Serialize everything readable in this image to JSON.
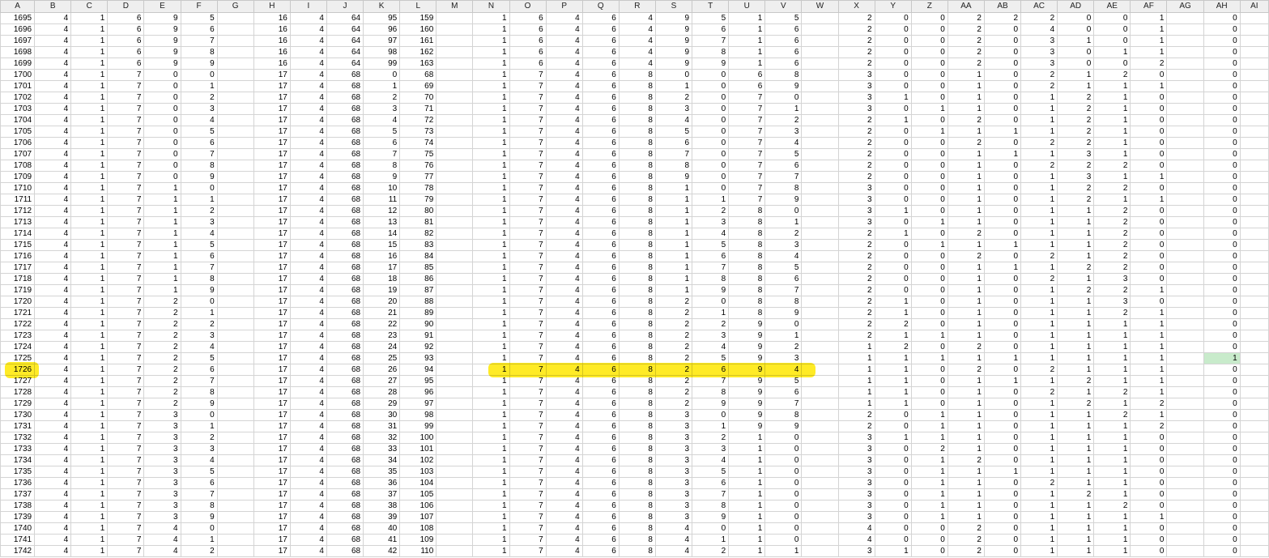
{
  "colors": {
    "highlight": "#ffe800",
    "selected_cell": "#c8ebcb",
    "header_bg": "#efefef",
    "grid_line": "#d4d4d4"
  },
  "columns": [
    "A",
    "B",
    "C",
    "D",
    "E",
    "F",
    "G",
    "H",
    "I",
    "J",
    "K",
    "L",
    "M",
    "N",
    "O",
    "P",
    "Q",
    "R",
    "S",
    "T",
    "U",
    "V",
    "W",
    "X",
    "Y",
    "Z",
    "AA",
    "AB",
    "AC",
    "AD",
    "AE",
    "AF",
    "AG",
    "AH",
    "AI"
  ],
  "highlighted_row_id": "1725",
  "selected_cell": {
    "row_id": "1725",
    "column": "AH"
  },
  "rows": [
    [
      "1695",
      "4",
      "1",
      "6",
      "9",
      "5",
      "",
      "16",
      "4",
      "64",
      "95",
      "159",
      "",
      "1",
      "6",
      "4",
      "6",
      "4",
      "9",
      "5",
      "1",
      "5",
      "",
      "2",
      "0",
      "0",
      "2",
      "2",
      "2",
      "0",
      "0",
      "1",
      "",
      "0",
      ""
    ],
    [
      "1696",
      "4",
      "1",
      "6",
      "9",
      "6",
      "",
      "16",
      "4",
      "64",
      "96",
      "160",
      "",
      "1",
      "6",
      "4",
      "6",
      "4",
      "9",
      "6",
      "1",
      "6",
      "",
      "2",
      "0",
      "0",
      "2",
      "0",
      "4",
      "0",
      "0",
      "1",
      "",
      "0",
      ""
    ],
    [
      "1697",
      "4",
      "1",
      "6",
      "9",
      "7",
      "",
      "16",
      "4",
      "64",
      "97",
      "161",
      "",
      "1",
      "6",
      "4",
      "6",
      "4",
      "9",
      "7",
      "1",
      "6",
      "",
      "2",
      "0",
      "0",
      "2",
      "0",
      "3",
      "1",
      "0",
      "1",
      "",
      "0",
      ""
    ],
    [
      "1698",
      "4",
      "1",
      "6",
      "9",
      "8",
      "",
      "16",
      "4",
      "64",
      "98",
      "162",
      "",
      "1",
      "6",
      "4",
      "6",
      "4",
      "9",
      "8",
      "1",
      "6",
      "",
      "2",
      "0",
      "0",
      "2",
      "0",
      "3",
      "0",
      "1",
      "1",
      "",
      "0",
      ""
    ],
    [
      "1699",
      "4",
      "1",
      "6",
      "9",
      "9",
      "",
      "16",
      "4",
      "64",
      "99",
      "163",
      "",
      "1",
      "6",
      "4",
      "6",
      "4",
      "9",
      "9",
      "1",
      "6",
      "",
      "2",
      "0",
      "0",
      "2",
      "0",
      "3",
      "0",
      "0",
      "2",
      "",
      "0",
      ""
    ],
    [
      "1700",
      "4",
      "1",
      "7",
      "0",
      "0",
      "",
      "17",
      "4",
      "68",
      "0",
      "68",
      "",
      "1",
      "7",
      "4",
      "6",
      "8",
      "0",
      "0",
      "6",
      "8",
      "",
      "3",
      "0",
      "0",
      "1",
      "0",
      "2",
      "1",
      "2",
      "0",
      "",
      "0",
      ""
    ],
    [
      "1701",
      "4",
      "1",
      "7",
      "0",
      "1",
      "",
      "17",
      "4",
      "68",
      "1",
      "69",
      "",
      "1",
      "7",
      "4",
      "6",
      "8",
      "1",
      "0",
      "6",
      "9",
      "",
      "3",
      "0",
      "0",
      "1",
      "0",
      "2",
      "1",
      "1",
      "1",
      "",
      "0",
      ""
    ],
    [
      "1702",
      "4",
      "1",
      "7",
      "0",
      "2",
      "",
      "17",
      "4",
      "68",
      "2",
      "70",
      "",
      "1",
      "7",
      "4",
      "6",
      "8",
      "2",
      "0",
      "7",
      "0",
      "",
      "3",
      "1",
      "0",
      "1",
      "0",
      "1",
      "2",
      "1",
      "0",
      "",
      "0",
      ""
    ],
    [
      "1703",
      "4",
      "1",
      "7",
      "0",
      "3",
      "",
      "17",
      "4",
      "68",
      "3",
      "71",
      "",
      "1",
      "7",
      "4",
      "6",
      "8",
      "3",
      "0",
      "7",
      "1",
      "",
      "3",
      "0",
      "1",
      "1",
      "0",
      "1",
      "2",
      "1",
      "0",
      "",
      "0",
      ""
    ],
    [
      "1704",
      "4",
      "1",
      "7",
      "0",
      "4",
      "",
      "17",
      "4",
      "68",
      "4",
      "72",
      "",
      "1",
      "7",
      "4",
      "6",
      "8",
      "4",
      "0",
      "7",
      "2",
      "",
      "2",
      "1",
      "0",
      "2",
      "0",
      "1",
      "2",
      "1",
      "0",
      "",
      "0",
      ""
    ],
    [
      "1705",
      "4",
      "1",
      "7",
      "0",
      "5",
      "",
      "17",
      "4",
      "68",
      "5",
      "73",
      "",
      "1",
      "7",
      "4",
      "6",
      "8",
      "5",
      "0",
      "7",
      "3",
      "",
      "2",
      "0",
      "1",
      "1",
      "1",
      "1",
      "2",
      "1",
      "0",
      "",
      "0",
      ""
    ],
    [
      "1706",
      "4",
      "1",
      "7",
      "0",
      "6",
      "",
      "17",
      "4",
      "68",
      "6",
      "74",
      "",
      "1",
      "7",
      "4",
      "6",
      "8",
      "6",
      "0",
      "7",
      "4",
      "",
      "2",
      "0",
      "0",
      "2",
      "0",
      "2",
      "2",
      "1",
      "0",
      "",
      "0",
      ""
    ],
    [
      "1707",
      "4",
      "1",
      "7",
      "0",
      "7",
      "",
      "17",
      "4",
      "68",
      "7",
      "75",
      "",
      "1",
      "7",
      "4",
      "6",
      "8",
      "7",
      "0",
      "7",
      "5",
      "",
      "2",
      "0",
      "0",
      "1",
      "1",
      "1",
      "3",
      "1",
      "0",
      "",
      "0",
      ""
    ],
    [
      "1708",
      "4",
      "1",
      "7",
      "0",
      "8",
      "",
      "17",
      "4",
      "68",
      "8",
      "76",
      "",
      "1",
      "7",
      "4",
      "6",
      "8",
      "8",
      "0",
      "7",
      "6",
      "",
      "2",
      "0",
      "0",
      "1",
      "0",
      "2",
      "2",
      "2",
      "0",
      "",
      "0",
      ""
    ],
    [
      "1709",
      "4",
      "1",
      "7",
      "0",
      "9",
      "",
      "17",
      "4",
      "68",
      "9",
      "77",
      "",
      "1",
      "7",
      "4",
      "6",
      "8",
      "9",
      "0",
      "7",
      "7",
      "",
      "2",
      "0",
      "0",
      "1",
      "0",
      "1",
      "3",
      "1",
      "1",
      "",
      "0",
      ""
    ],
    [
      "1710",
      "4",
      "1",
      "7",
      "1",
      "0",
      "",
      "17",
      "4",
      "68",
      "10",
      "78",
      "",
      "1",
      "7",
      "4",
      "6",
      "8",
      "1",
      "0",
      "7",
      "8",
      "",
      "3",
      "0",
      "0",
      "1",
      "0",
      "1",
      "2",
      "2",
      "0",
      "",
      "0",
      ""
    ],
    [
      "1711",
      "4",
      "1",
      "7",
      "1",
      "1",
      "",
      "17",
      "4",
      "68",
      "11",
      "79",
      "",
      "1",
      "7",
      "4",
      "6",
      "8",
      "1",
      "1",
      "7",
      "9",
      "",
      "3",
      "0",
      "0",
      "1",
      "0",
      "1",
      "2",
      "1",
      "1",
      "",
      "0",
      ""
    ],
    [
      "1712",
      "4",
      "1",
      "7",
      "1",
      "2",
      "",
      "17",
      "4",
      "68",
      "12",
      "80",
      "",
      "1",
      "7",
      "4",
      "6",
      "8",
      "1",
      "2",
      "8",
      "0",
      "",
      "3",
      "1",
      "0",
      "1",
      "0",
      "1",
      "1",
      "2",
      "0",
      "",
      "0",
      ""
    ],
    [
      "1713",
      "4",
      "1",
      "7",
      "1",
      "3",
      "",
      "17",
      "4",
      "68",
      "13",
      "81",
      "",
      "1",
      "7",
      "4",
      "6",
      "8",
      "1",
      "3",
      "8",
      "1",
      "",
      "3",
      "0",
      "1",
      "1",
      "0",
      "1",
      "1",
      "2",
      "0",
      "",
      "0",
      ""
    ],
    [
      "1714",
      "4",
      "1",
      "7",
      "1",
      "4",
      "",
      "17",
      "4",
      "68",
      "14",
      "82",
      "",
      "1",
      "7",
      "4",
      "6",
      "8",
      "1",
      "4",
      "8",
      "2",
      "",
      "2",
      "1",
      "0",
      "2",
      "0",
      "1",
      "1",
      "2",
      "0",
      "",
      "0",
      ""
    ],
    [
      "1715",
      "4",
      "1",
      "7",
      "1",
      "5",
      "",
      "17",
      "4",
      "68",
      "15",
      "83",
      "",
      "1",
      "7",
      "4",
      "6",
      "8",
      "1",
      "5",
      "8",
      "3",
      "",
      "2",
      "0",
      "1",
      "1",
      "1",
      "1",
      "1",
      "2",
      "0",
      "",
      "0",
      ""
    ],
    [
      "1716",
      "4",
      "1",
      "7",
      "1",
      "6",
      "",
      "17",
      "4",
      "68",
      "16",
      "84",
      "",
      "1",
      "7",
      "4",
      "6",
      "8",
      "1",
      "6",
      "8",
      "4",
      "",
      "2",
      "0",
      "0",
      "2",
      "0",
      "2",
      "1",
      "2",
      "0",
      "",
      "0",
      ""
    ],
    [
      "1717",
      "4",
      "1",
      "7",
      "1",
      "7",
      "",
      "17",
      "4",
      "68",
      "17",
      "85",
      "",
      "1",
      "7",
      "4",
      "6",
      "8",
      "1",
      "7",
      "8",
      "5",
      "",
      "2",
      "0",
      "0",
      "1",
      "1",
      "1",
      "2",
      "2",
      "0",
      "",
      "0",
      ""
    ],
    [
      "1718",
      "4",
      "1",
      "7",
      "1",
      "8",
      "",
      "17",
      "4",
      "68",
      "18",
      "86",
      "",
      "1",
      "7",
      "4",
      "6",
      "8",
      "1",
      "8",
      "8",
      "6",
      "",
      "2",
      "0",
      "0",
      "1",
      "0",
      "2",
      "1",
      "3",
      "0",
      "",
      "0",
      ""
    ],
    [
      "1719",
      "4",
      "1",
      "7",
      "1",
      "9",
      "",
      "17",
      "4",
      "68",
      "19",
      "87",
      "",
      "1",
      "7",
      "4",
      "6",
      "8",
      "1",
      "9",
      "8",
      "7",
      "",
      "2",
      "0",
      "0",
      "1",
      "0",
      "1",
      "2",
      "2",
      "1",
      "",
      "0",
      ""
    ],
    [
      "1720",
      "4",
      "1",
      "7",
      "2",
      "0",
      "",
      "17",
      "4",
      "68",
      "20",
      "88",
      "",
      "1",
      "7",
      "4",
      "6",
      "8",
      "2",
      "0",
      "8",
      "8",
      "",
      "2",
      "1",
      "0",
      "1",
      "0",
      "1",
      "1",
      "3",
      "0",
      "",
      "0",
      ""
    ],
    [
      "1721",
      "4",
      "1",
      "7",
      "2",
      "1",
      "",
      "17",
      "4",
      "68",
      "21",
      "89",
      "",
      "1",
      "7",
      "4",
      "6",
      "8",
      "2",
      "1",
      "8",
      "9",
      "",
      "2",
      "1",
      "0",
      "1",
      "0",
      "1",
      "1",
      "2",
      "1",
      "",
      "0",
      ""
    ],
    [
      "1722",
      "4",
      "1",
      "7",
      "2",
      "2",
      "",
      "17",
      "4",
      "68",
      "22",
      "90",
      "",
      "1",
      "7",
      "4",
      "6",
      "8",
      "2",
      "2",
      "9",
      "0",
      "",
      "2",
      "2",
      "0",
      "1",
      "0",
      "1",
      "1",
      "1",
      "1",
      "",
      "0",
      ""
    ],
    [
      "1723",
      "4",
      "1",
      "7",
      "2",
      "3",
      "",
      "17",
      "4",
      "68",
      "23",
      "91",
      "",
      "1",
      "7",
      "4",
      "6",
      "8",
      "2",
      "3",
      "9",
      "1",
      "",
      "2",
      "1",
      "1",
      "1",
      "0",
      "1",
      "1",
      "1",
      "1",
      "",
      "0",
      ""
    ],
    [
      "1724",
      "4",
      "1",
      "7",
      "2",
      "4",
      "",
      "17",
      "4",
      "68",
      "24",
      "92",
      "",
      "1",
      "7",
      "4",
      "6",
      "8",
      "2",
      "4",
      "9",
      "2",
      "",
      "1",
      "2",
      "0",
      "2",
      "0",
      "1",
      "1",
      "1",
      "1",
      "",
      "0",
      ""
    ],
    [
      "1725",
      "4",
      "1",
      "7",
      "2",
      "5",
      "",
      "17",
      "4",
      "68",
      "25",
      "93",
      "",
      "1",
      "7",
      "4",
      "6",
      "8",
      "2",
      "5",
      "9",
      "3",
      "",
      "1",
      "1",
      "1",
      "1",
      "1",
      "1",
      "1",
      "1",
      "1",
      "",
      "1",
      ""
    ],
    [
      "1726",
      "4",
      "1",
      "7",
      "2",
      "6",
      "",
      "17",
      "4",
      "68",
      "26",
      "94",
      "",
      "1",
      "7",
      "4",
      "6",
      "8",
      "2",
      "6",
      "9",
      "4",
      "",
      "1",
      "1",
      "0",
      "2",
      "0",
      "2",
      "1",
      "1",
      "1",
      "",
      "0",
      ""
    ],
    [
      "1727",
      "4",
      "1",
      "7",
      "2",
      "7",
      "",
      "17",
      "4",
      "68",
      "27",
      "95",
      "",
      "1",
      "7",
      "4",
      "6",
      "8",
      "2",
      "7",
      "9",
      "5",
      "",
      "1",
      "1",
      "0",
      "1",
      "1",
      "1",
      "2",
      "1",
      "1",
      "",
      "0",
      ""
    ],
    [
      "1728",
      "4",
      "1",
      "7",
      "2",
      "8",
      "",
      "17",
      "4",
      "68",
      "28",
      "96",
      "",
      "1",
      "7",
      "4",
      "6",
      "8",
      "2",
      "8",
      "9",
      "6",
      "",
      "1",
      "1",
      "0",
      "1",
      "0",
      "2",
      "1",
      "2",
      "1",
      "",
      "0",
      ""
    ],
    [
      "1729",
      "4",
      "1",
      "7",
      "2",
      "9",
      "",
      "17",
      "4",
      "68",
      "29",
      "97",
      "",
      "1",
      "7",
      "4",
      "6",
      "8",
      "2",
      "9",
      "9",
      "7",
      "",
      "1",
      "1",
      "0",
      "1",
      "0",
      "1",
      "2",
      "1",
      "2",
      "",
      "0",
      ""
    ],
    [
      "1730",
      "4",
      "1",
      "7",
      "3",
      "0",
      "",
      "17",
      "4",
      "68",
      "30",
      "98",
      "",
      "1",
      "7",
      "4",
      "6",
      "8",
      "3",
      "0",
      "9",
      "8",
      "",
      "2",
      "0",
      "1",
      "1",
      "0",
      "1",
      "1",
      "2",
      "1",
      "",
      "0",
      ""
    ],
    [
      "1731",
      "4",
      "1",
      "7",
      "3",
      "1",
      "",
      "17",
      "4",
      "68",
      "31",
      "99",
      "",
      "1",
      "7",
      "4",
      "6",
      "8",
      "3",
      "1",
      "9",
      "9",
      "",
      "2",
      "0",
      "1",
      "1",
      "0",
      "1",
      "1",
      "1",
      "2",
      "",
      "0",
      ""
    ],
    [
      "1732",
      "4",
      "1",
      "7",
      "3",
      "2",
      "",
      "17",
      "4",
      "68",
      "32",
      "100",
      "",
      "1",
      "7",
      "4",
      "6",
      "8",
      "3",
      "2",
      "1",
      "0",
      "",
      "3",
      "1",
      "1",
      "1",
      "0",
      "1",
      "1",
      "1",
      "0",
      "",
      "0",
      ""
    ],
    [
      "1733",
      "4",
      "1",
      "7",
      "3",
      "3",
      "",
      "17",
      "4",
      "68",
      "33",
      "101",
      "",
      "1",
      "7",
      "4",
      "6",
      "8",
      "3",
      "3",
      "1",
      "0",
      "",
      "3",
      "0",
      "2",
      "1",
      "0",
      "1",
      "1",
      "1",
      "0",
      "",
      "0",
      ""
    ],
    [
      "1734",
      "4",
      "1",
      "7",
      "3",
      "4",
      "",
      "17",
      "4",
      "68",
      "34",
      "102",
      "",
      "1",
      "7",
      "4",
      "6",
      "8",
      "3",
      "4",
      "1",
      "0",
      "",
      "3",
      "0",
      "1",
      "2",
      "0",
      "1",
      "1",
      "1",
      "0",
      "",
      "0",
      ""
    ],
    [
      "1735",
      "4",
      "1",
      "7",
      "3",
      "5",
      "",
      "17",
      "4",
      "68",
      "35",
      "103",
      "",
      "1",
      "7",
      "4",
      "6",
      "8",
      "3",
      "5",
      "1",
      "0",
      "",
      "3",
      "0",
      "1",
      "1",
      "1",
      "1",
      "1",
      "1",
      "0",
      "",
      "0",
      ""
    ],
    [
      "1736",
      "4",
      "1",
      "7",
      "3",
      "6",
      "",
      "17",
      "4",
      "68",
      "36",
      "104",
      "",
      "1",
      "7",
      "4",
      "6",
      "8",
      "3",
      "6",
      "1",
      "0",
      "",
      "3",
      "0",
      "1",
      "1",
      "0",
      "2",
      "1",
      "1",
      "0",
      "",
      "0",
      ""
    ],
    [
      "1737",
      "4",
      "1",
      "7",
      "3",
      "7",
      "",
      "17",
      "4",
      "68",
      "37",
      "105",
      "",
      "1",
      "7",
      "4",
      "6",
      "8",
      "3",
      "7",
      "1",
      "0",
      "",
      "3",
      "0",
      "1",
      "1",
      "0",
      "1",
      "2",
      "1",
      "0",
      "",
      "0",
      ""
    ],
    [
      "1738",
      "4",
      "1",
      "7",
      "3",
      "8",
      "",
      "17",
      "4",
      "68",
      "38",
      "106",
      "",
      "1",
      "7",
      "4",
      "6",
      "8",
      "3",
      "8",
      "1",
      "0",
      "",
      "3",
      "0",
      "1",
      "1",
      "0",
      "1",
      "1",
      "2",
      "0",
      "",
      "0",
      ""
    ],
    [
      "1739",
      "4",
      "1",
      "7",
      "3",
      "9",
      "",
      "17",
      "4",
      "68",
      "39",
      "107",
      "",
      "1",
      "7",
      "4",
      "6",
      "8",
      "3",
      "9",
      "1",
      "0",
      "",
      "3",
      "0",
      "1",
      "1",
      "0",
      "1",
      "1",
      "1",
      "1",
      "",
      "0",
      ""
    ],
    [
      "1740",
      "4",
      "1",
      "7",
      "4",
      "0",
      "",
      "17",
      "4",
      "68",
      "40",
      "108",
      "",
      "1",
      "7",
      "4",
      "6",
      "8",
      "4",
      "0",
      "1",
      "0",
      "",
      "4",
      "0",
      "0",
      "2",
      "0",
      "1",
      "1",
      "1",
      "0",
      "",
      "0",
      ""
    ],
    [
      "1741",
      "4",
      "1",
      "7",
      "4",
      "1",
      "",
      "17",
      "4",
      "68",
      "41",
      "109",
      "",
      "1",
      "7",
      "4",
      "6",
      "8",
      "4",
      "1",
      "1",
      "0",
      "",
      "4",
      "0",
      "0",
      "2",
      "0",
      "1",
      "1",
      "1",
      "0",
      "",
      "0",
      ""
    ],
    [
      "1742",
      "4",
      "1",
      "7",
      "4",
      "2",
      "",
      "17",
      "4",
      "68",
      "42",
      "110",
      "",
      "1",
      "7",
      "4",
      "6",
      "8",
      "4",
      "2",
      "1",
      "1",
      "",
      "3",
      "1",
      "0",
      "2",
      "0",
      "1",
      "1",
      "1",
      "0",
      "",
      "0",
      ""
    ]
  ]
}
